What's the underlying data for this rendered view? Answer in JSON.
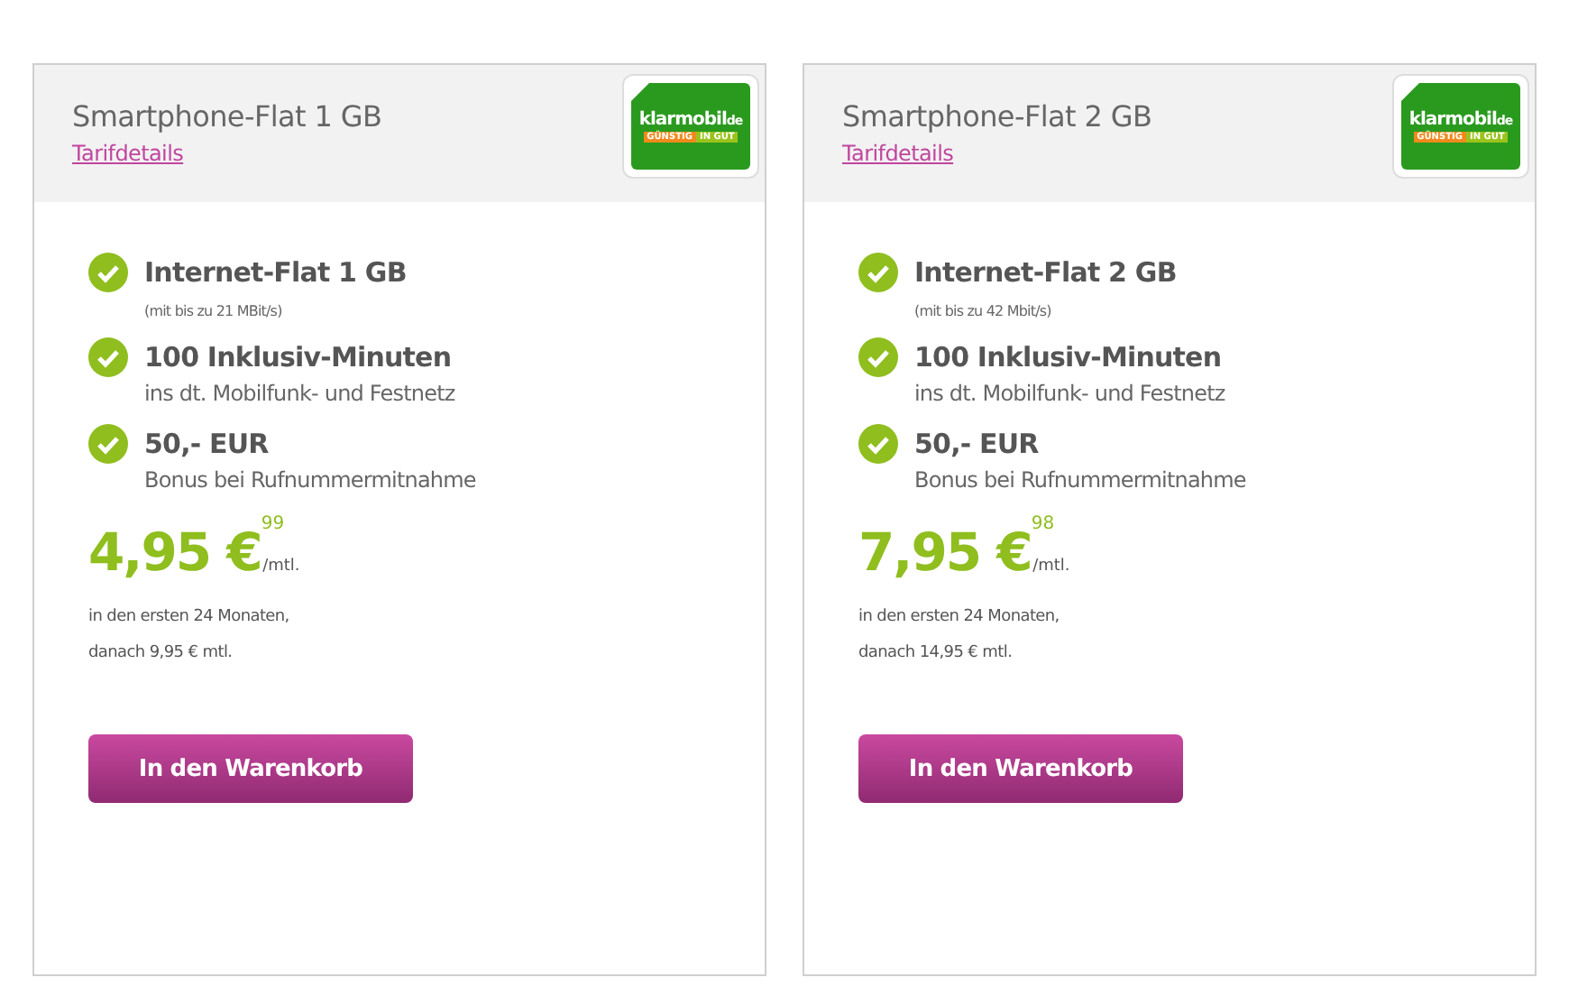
{
  "cards": [
    {
      "title": "Smartphone-Flat 1 GB",
      "details_link": "Tarifdetails",
      "logo": {
        "brand": "klarmobil",
        "domain": "de",
        "tag_left": "GÜNSTIG",
        "tag_right": "IN GUT"
      },
      "features": [
        {
          "title": "Internet-Flat 1 GB",
          "note": "(mit bis zu 21 MBit/s)",
          "small": true
        },
        {
          "title": "100 Inklusiv-Minuten",
          "note": "ins dt. Mobilfunk- und Festnetz",
          "small": false
        },
        {
          "title": "50,- EUR",
          "note": "Bonus bei Rufnummermitnahme",
          "small": false
        }
      ],
      "price": "4,95 €",
      "cents": "99",
      "per": "/mtl.",
      "conditions": [
        "in den ersten 24 Monaten,",
        "danach 9,95 € mtl."
      ],
      "button": "In den Warenkorb"
    },
    {
      "title": "Smartphone-Flat 2 GB",
      "details_link": "Tarifdetails",
      "logo": {
        "brand": "klarmobil",
        "domain": "de",
        "tag_left": "GÜNSTIG",
        "tag_right": "IN GUT"
      },
      "features": [
        {
          "title": "Internet-Flat 2 GB",
          "note": "(mit bis zu 42 Mbit/s)",
          "small": true
        },
        {
          "title": "100 Inklusiv-Minuten",
          "note": "ins dt. Mobilfunk- und Festnetz",
          "small": false
        },
        {
          "title": "50,- EUR",
          "note": "Bonus bei Rufnummermitnahme",
          "small": false
        }
      ],
      "price": "7,95 €",
      "cents": "98",
      "per": "/mtl.",
      "conditions": [
        "in den ersten 24 Monaten,",
        "danach 14,95 € mtl."
      ],
      "button": "In den Warenkorb"
    }
  ]
}
